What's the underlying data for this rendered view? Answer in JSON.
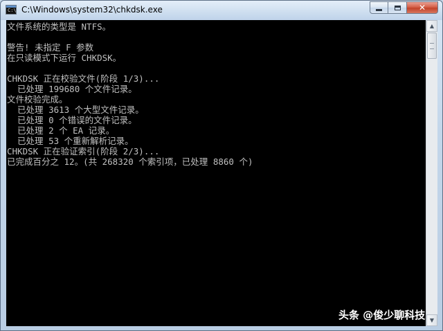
{
  "window": {
    "title": "C:\\Windows\\system32\\chkdsk.exe",
    "icon_name": "cmd-console-icon",
    "icon_text": "C:\\",
    "controls": {
      "minimize": "minimize-icon",
      "maximize": "maximize-icon",
      "close": "close-icon",
      "close_glyph": "✕"
    }
  },
  "console": {
    "background": "#000000",
    "foreground": "#c0c0c0",
    "lines": [
      "文件系统的类型是 NTFS。",
      "",
      "警告! 未指定 F 参数",
      "在只读模式下运行 CHKDSK。",
      "",
      "CHKDSK 正在校验文件(阶段 1/3)...",
      "  已处理 199680 个文件记录。",
      "文件校验完成。",
      "  已处理 3613 个大型文件记录。",
      "  已处理 0 个错误的文件记录。",
      "  已处理 2 个 EA 记录。",
      "  已处理 53 个重新解析记录。",
      "CHKDSK 正在验证索引(阶段 2/3)...",
      "已完成百分之 12。(共 268320 个索引项，已处理 8860 个)"
    ]
  },
  "scrollbar": {
    "up_glyph": "▲",
    "down_glyph": "▼"
  },
  "watermark": {
    "text": "头条 @俊少聊科技"
  }
}
